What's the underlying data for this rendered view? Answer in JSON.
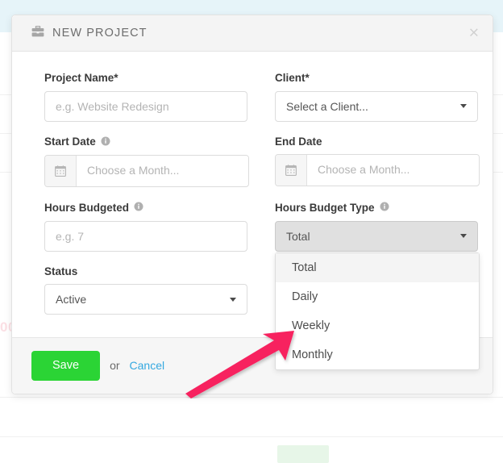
{
  "modal": {
    "title": "NEW PROJECT",
    "title_icon": "briefcase-icon",
    "close_label": "×"
  },
  "form": {
    "project_name": {
      "label": "Project Name*",
      "placeholder": "e.g. Website Redesign",
      "value": ""
    },
    "client": {
      "label": "Client*",
      "value": "Select a Client..."
    },
    "start_date": {
      "label": "Start Date",
      "has_info_icon": true,
      "placeholder": "Choose a Month...",
      "value": "",
      "addon_icon": "calendar-icon"
    },
    "end_date": {
      "label": "End Date",
      "has_info_icon": false,
      "placeholder": "Choose a Month...",
      "value": "",
      "addon_icon": "calendar-icon"
    },
    "hours_budgeted": {
      "label": "Hours Budgeted",
      "has_info_icon": true,
      "placeholder": "e.g. 7",
      "value": ""
    },
    "hours_budget_type": {
      "label": "Hours Budget Type",
      "has_info_icon": true,
      "value": "Total",
      "options": [
        "Total",
        "Daily",
        "Weekly",
        "Monthly"
      ],
      "highlighted_option": "Total",
      "open": true
    },
    "status": {
      "label": "Status",
      "value": "Active"
    }
  },
  "footer": {
    "save_label": "Save",
    "or_label": "or",
    "cancel_label": "Cancel"
  },
  "background": {
    "ghost_number": "00"
  },
  "colors": {
    "save_green": "#2bd435",
    "cancel_blue": "#34a8e0",
    "arrow_pink": "#f7215f",
    "topbar_blue": "#e6f4f9",
    "select_active_gray": "#e0e0e0"
  }
}
